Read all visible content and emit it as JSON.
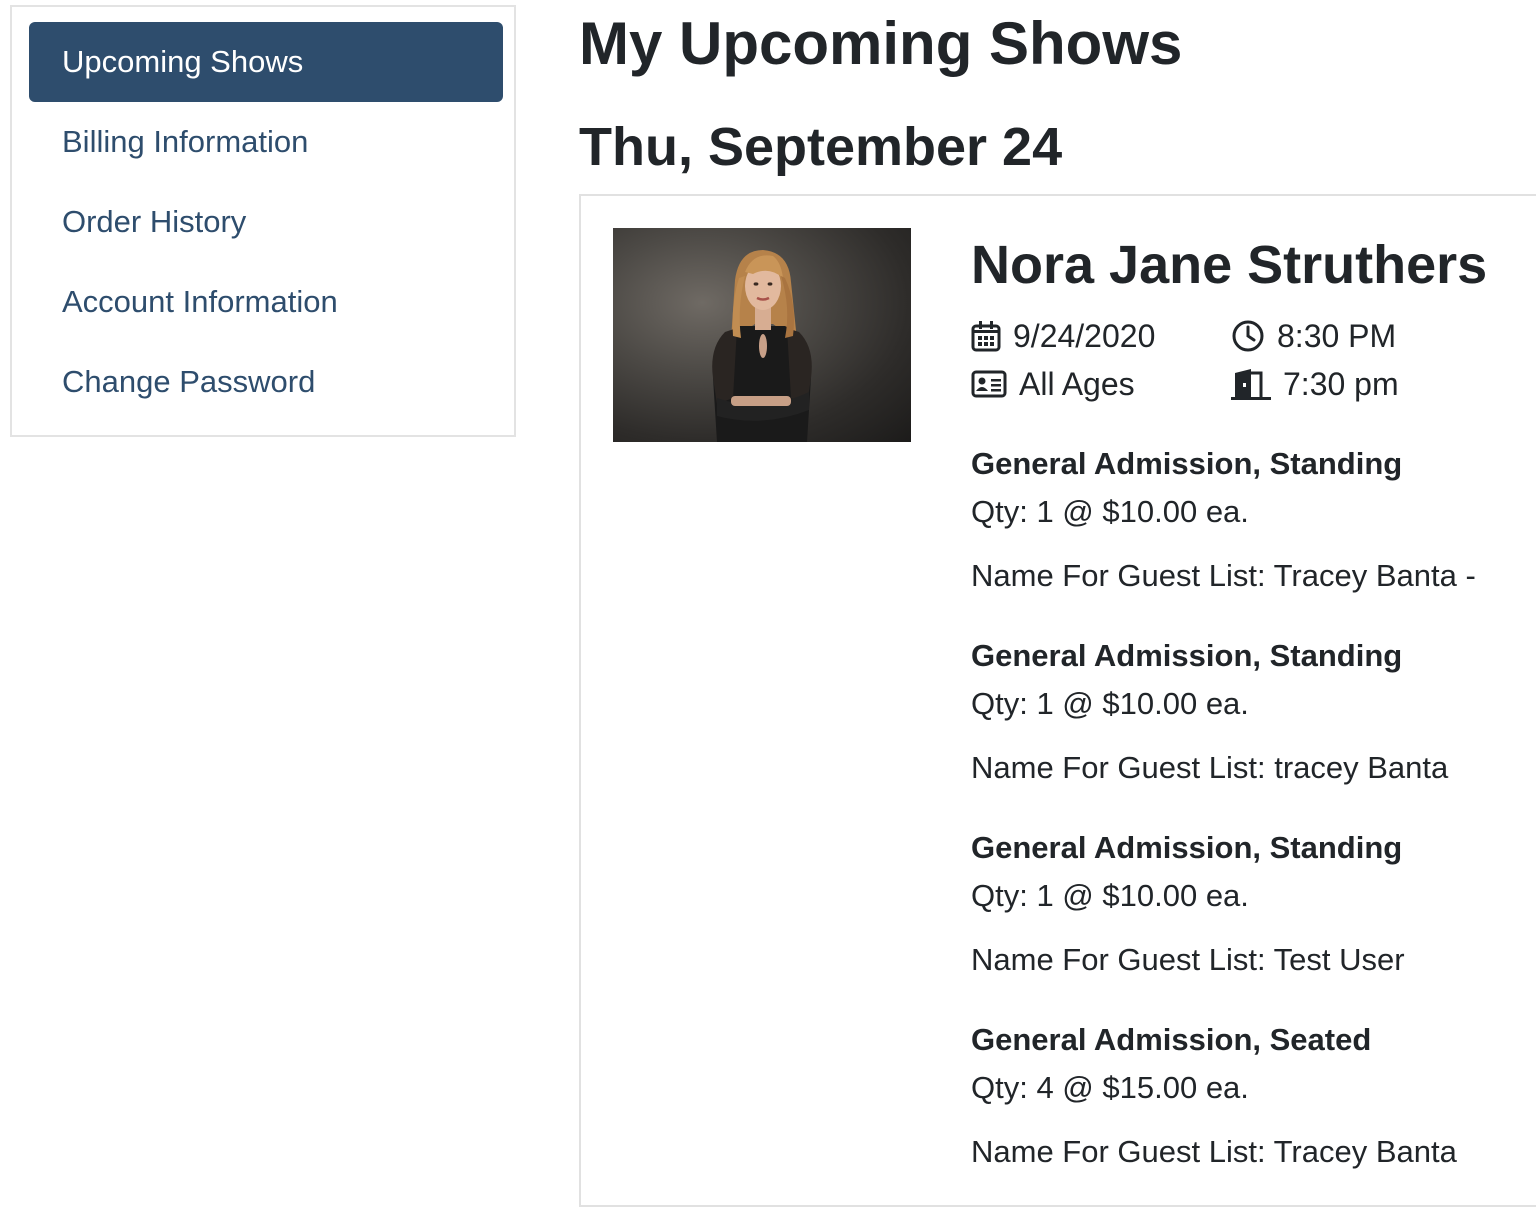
{
  "sidebar": {
    "items": [
      {
        "label": "Upcoming Shows",
        "active": true
      },
      {
        "label": "Billing Information"
      },
      {
        "label": "Order History"
      },
      {
        "label": "Account Information"
      },
      {
        "label": "Change Password"
      }
    ]
  },
  "page": {
    "title": "My Upcoming Shows",
    "date_heading": "Thu, September 24"
  },
  "show": {
    "image_icon": "artist-photo",
    "artist": "Nora Jane Struthers",
    "date": "9/24/2020",
    "time": "8:30 PM",
    "age": "All Ages",
    "doors": "7:30 pm",
    "icons": {
      "date": "calendar-icon",
      "time": "clock-icon",
      "age": "id-card-icon",
      "doors": "door-icon"
    },
    "tickets": [
      {
        "type": "General Admission, Standing",
        "qty": "Qty: 1 @ $10.00 ea.",
        "guest": "Name For Guest List: Tracey Banta -"
      },
      {
        "type": "General Admission, Standing",
        "qty": "Qty: 1 @ $10.00 ea.",
        "guest": "Name For Guest List: tracey Banta"
      },
      {
        "type": "General Admission, Standing",
        "qty": "Qty: 1 @ $10.00 ea.",
        "guest": "Name For Guest List: Test User"
      },
      {
        "type": "General Admission, Seated",
        "qty": "Qty: 4 @ $15.00 ea.",
        "guest": "Name For Guest List: Tracey Banta"
      }
    ]
  },
  "colors": {
    "accent": "#2e4d6d",
    "text": "#212529",
    "border": "#e3e3e3"
  }
}
